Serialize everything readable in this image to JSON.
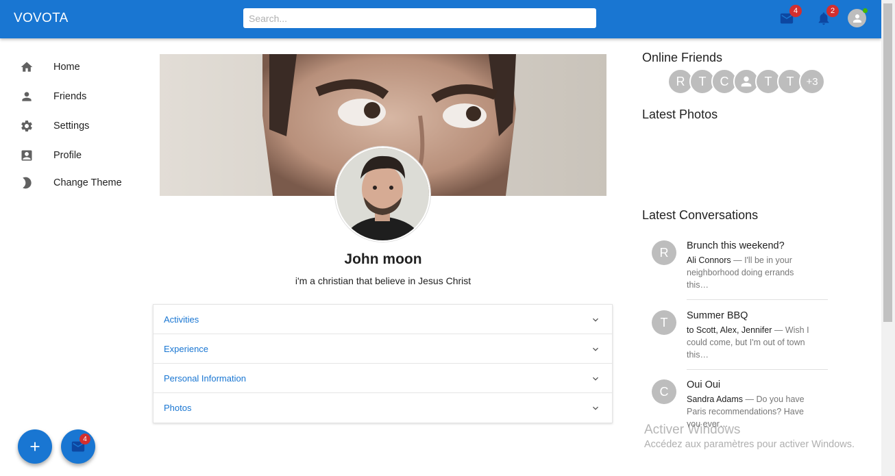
{
  "header": {
    "brand": "VOVOTA",
    "search_placeholder": "Search...",
    "mail_badge": "4",
    "notif_badge": "2"
  },
  "sidebar": {
    "items": [
      {
        "label": "Home",
        "icon": "home-icon"
      },
      {
        "label": "Friends",
        "icon": "person-icon"
      },
      {
        "label": "Settings",
        "icon": "gear-icon"
      },
      {
        "label": "Profile",
        "icon": "contact-card-icon"
      },
      {
        "label": "Change Theme",
        "icon": "moon-icon"
      }
    ]
  },
  "profile": {
    "name": "John moon",
    "bio": "i'm a christian that believe in Jesus Christ"
  },
  "accordion": [
    {
      "label": "Activities"
    },
    {
      "label": "Experience"
    },
    {
      "label": "Personal Information"
    },
    {
      "label": "Photos"
    }
  ],
  "right": {
    "online_title": "Online Friends",
    "friends": [
      "R",
      "T",
      "C",
      "",
      "T",
      "T",
      "+3"
    ],
    "photos_title": "Latest Photos",
    "conversations_title": "Latest Conversations",
    "conversations": [
      {
        "initial": "R",
        "title": "Brunch this weekend?",
        "sender": "Ali Connors",
        "text": " — I'll be in your neighborhood doing errands this…"
      },
      {
        "initial": "T",
        "title": "Summer BBQ",
        "sender": "to Scott, Alex, Jennifer",
        "text": " — Wish I could come, but I'm out of town this…"
      },
      {
        "initial": "C",
        "title": "Oui Oui",
        "sender": "Sandra Adams",
        "text": " — Do you have Paris recommendations? Have you ever…"
      }
    ]
  },
  "watermark": {
    "title": "Activer Windows",
    "subtitle": "Accédez aux paramètres pour activer Windows."
  },
  "fab": {
    "add_icon": "plus-icon",
    "mail_badge": "4"
  },
  "colors": {
    "primary": "#1976d2",
    "badge": "#d32f2f",
    "online": "#44b700"
  }
}
